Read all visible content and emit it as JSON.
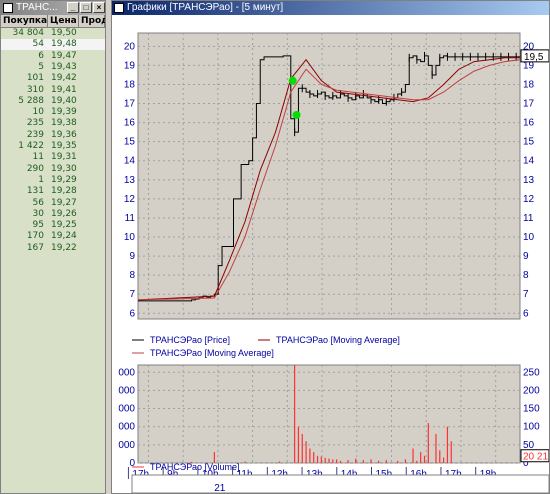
{
  "left_window": {
    "title": "ТРАНС...",
    "columns": [
      "Покупка",
      "Цена",
      "Прод"
    ],
    "rows": [
      {
        "qty": "34 804",
        "price": "19,50"
      },
      {
        "qty": "54",
        "price": "19,48"
      },
      {
        "qty": "6",
        "price": "19,47"
      },
      {
        "qty": "5",
        "price": "19,43"
      },
      {
        "qty": "101",
        "price": "19,42"
      },
      {
        "qty": "310",
        "price": "19,41"
      },
      {
        "qty": "5 288",
        "price": "19,40"
      },
      {
        "qty": "10",
        "price": "19,39"
      },
      {
        "qty": "235",
        "price": "19,38"
      },
      {
        "qty": "239",
        "price": "19,36"
      },
      {
        "qty": "1 422",
        "price": "19,35"
      },
      {
        "qty": "11",
        "price": "19,31"
      },
      {
        "qty": "290",
        "price": "19,30"
      },
      {
        "qty": "1",
        "price": "19,29"
      },
      {
        "qty": "131",
        "price": "19,28"
      },
      {
        "qty": "56",
        "price": "19,27"
      },
      {
        "qty": "30",
        "price": "19,26"
      },
      {
        "qty": "95",
        "price": "19,25"
      },
      {
        "qty": "170",
        "price": "19,24"
      },
      {
        "qty": "167",
        "price": "19,22"
      }
    ],
    "selected_row": 1
  },
  "chart_window": {
    "title": "Графики [ТРАНСЭРао] - [5 минут]",
    "current_price_label": "19,5",
    "current_volume_label": "20 21",
    "date_label": "21",
    "window_buttons": {
      "minimize": "_",
      "restore": "□",
      "close": "×"
    }
  },
  "colors": {
    "price": "#000000",
    "ma_fast": "#8b0000",
    "ma_slow": "#c04040",
    "volume": "#ff3030",
    "grid": "#a0a0a0",
    "axis_text": "#0000a0",
    "marker": "#00e000"
  },
  "chart_data": [
    {
      "type": "line",
      "panel": "price",
      "y_ticks": [
        6,
        7,
        8,
        9,
        10,
        11,
        12,
        13,
        14,
        15,
        16,
        17,
        18,
        19,
        20
      ],
      "ylim": [
        5.7,
        20.7
      ],
      "xlim": [
        0,
        100
      ],
      "series": [
        {
          "name": "ТРАНСЭРао [Price]",
          "style": "step",
          "x": [
            0,
            14,
            15,
            16,
            17,
            18,
            19,
            20,
            21,
            22,
            23,
            24,
            25,
            26,
            27,
            28,
            29,
            30,
            31,
            32,
            33,
            34,
            35,
            36,
            37,
            38,
            39,
            40,
            41,
            42,
            43,
            44,
            45,
            46,
            47,
            48,
            49,
            50,
            51,
            52,
            53,
            54,
            55,
            56,
            57,
            58,
            59,
            60,
            61,
            62,
            63,
            64,
            65,
            66,
            67,
            68,
            69,
            70,
            71,
            72,
            73,
            74,
            75,
            76,
            77,
            78,
            79,
            80,
            81,
            82,
            83,
            84,
            85,
            86,
            87,
            88,
            89,
            90,
            91,
            92,
            93,
            94,
            95,
            96,
            97,
            98,
            99,
            100
          ],
          "y": [
            6.65,
            6.7,
            6.75,
            6.8,
            6.9,
            6.85,
            6.9,
            7.0,
            8.5,
            9.5,
            9.5,
            9.5,
            12.0,
            12.0,
            13.8,
            13.8,
            14.0,
            15.2,
            17.0,
            19.3,
            19.45,
            19.45,
            19.45,
            19.45,
            19.45,
            19.5,
            19.5,
            16.2,
            15.5,
            17.8,
            17.8,
            17.6,
            17.5,
            17.4,
            17.5,
            17.6,
            17.4,
            17.3,
            17.4,
            17.3,
            17.5,
            17.4,
            17.3,
            17.2,
            17.4,
            17.3,
            17.5,
            17.3,
            17.2,
            17.1,
            17.2,
            17.0,
            17.1,
            17.2,
            17.3,
            17.5,
            17.6,
            18.0,
            19.4,
            19.5,
            19.3,
            19.2,
            19.5,
            19.0,
            18.5,
            19.0,
            19.4,
            19.5,
            19.45,
            19.45,
            19.45,
            19.45,
            19.45,
            19.45,
            19.45,
            19.45,
            19.45,
            19.45,
            19.45,
            19.45,
            19.45,
            19.45,
            19.45,
            19.45,
            19.45,
            19.45,
            19.45,
            19.45
          ]
        },
        {
          "name": "ТРАНСЭРао [Moving Average]",
          "color_key": "ma_fast",
          "x": [
            0,
            20,
            24,
            28,
            32,
            36,
            40,
            44,
            48,
            52,
            56,
            60,
            64,
            68,
            72,
            76,
            80,
            84,
            88,
            92,
            96,
            100
          ],
          "y": [
            6.7,
            6.9,
            8.8,
            10.8,
            13.5,
            15.5,
            18.3,
            19.3,
            18.2,
            17.6,
            17.5,
            17.4,
            17.3,
            17.2,
            17.1,
            17.3,
            18.0,
            18.8,
            19.2,
            19.3,
            19.4,
            19.4
          ]
        },
        {
          "name": "ТРАНСЭРао [Moving Average]",
          "color_key": "ma_slow",
          "x": [
            0,
            20,
            24,
            28,
            32,
            36,
            40,
            44,
            48,
            52,
            56,
            60,
            64,
            68,
            72,
            76,
            80,
            84,
            88,
            92,
            96,
            100
          ],
          "y": [
            6.7,
            6.8,
            8.2,
            10.0,
            12.5,
            14.8,
            17.6,
            18.8,
            18.0,
            17.7,
            17.6,
            17.5,
            17.4,
            17.3,
            17.2,
            17.2,
            17.6,
            18.2,
            18.7,
            19.0,
            19.2,
            19.3
          ]
        }
      ],
      "legend": [
        "ТРАНСЭРао [Price]",
        "ТРАНСЭРао [Moving Average]",
        "ТРАНСЭРао [Moving Average]"
      ]
    },
    {
      "type": "bar",
      "panel": "volume",
      "series": [
        {
          "name": "ТРАНСЭРао [Volume]"
        }
      ],
      "y_ticks_left": [
        "0",
        "000",
        "000",
        "000",
        "000",
        "000",
        "000"
      ],
      "y_ticks_right": [
        "0",
        "50",
        "100",
        "150",
        "200",
        "250"
      ],
      "ylim": [
        0,
        270
      ],
      "x": [
        14,
        20,
        28,
        37,
        41,
        42,
        43,
        44,
        45,
        46,
        47,
        48,
        49,
        50,
        51,
        52,
        53,
        55,
        57,
        59,
        61,
        63,
        65,
        68,
        70,
        72,
        73,
        74,
        75,
        76,
        78,
        79,
        80,
        81,
        82
      ],
      "values": [
        3,
        30,
        4,
        4,
        270,
        100,
        80,
        60,
        40,
        30,
        20,
        18,
        14,
        12,
        10,
        10,
        6,
        8,
        12,
        8,
        10,
        6,
        8,
        6,
        10,
        40,
        6,
        30,
        20,
        110,
        80,
        35,
        15,
        100,
        60
      ],
      "x_tick_labels": [
        "17h",
        "9h",
        "10h",
        "11h",
        "12h",
        "13h",
        "14h",
        "15h",
        "16h",
        "17h",
        "18h"
      ]
    }
  ],
  "legend_labels": {
    "price": "ТРАНСЭРао [Price]",
    "ma1": "ТРАНСЭРао [Moving Average]",
    "ma2": "ТРАНСЭРао [Moving Average]",
    "volume": "ТРАНСЭРао [Volume]"
  }
}
